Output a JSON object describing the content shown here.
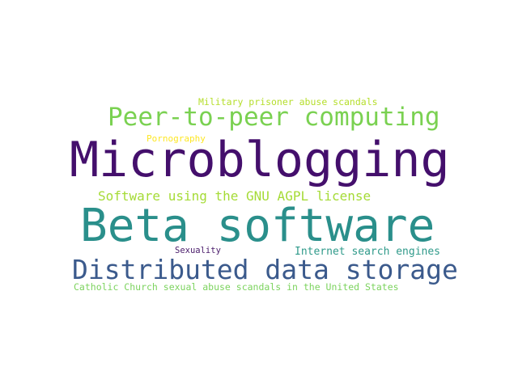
{
  "word_cloud": {
    "words": [
      {
        "id": "w-military",
        "text": "Military prisoner abuse scandals",
        "color": "#b5de2b"
      },
      {
        "id": "w-p2p",
        "text": "Peer-to-peer computing",
        "color": "#7ad151"
      },
      {
        "id": "w-porn",
        "text": "Pornography",
        "color": "#fde725"
      },
      {
        "id": "w-micro",
        "text": "Microblogging",
        "color": "#440f6c"
      },
      {
        "id": "w-agpl",
        "text": "Software using the GNU AGPL license",
        "color": "#a5db36"
      },
      {
        "id": "w-beta",
        "text": "Beta software",
        "color": "#2a8f8b"
      },
      {
        "id": "w-sex",
        "text": "Sexuality",
        "color": "#4a1c6b"
      },
      {
        "id": "w-isearch",
        "text": "Internet search engines",
        "color": "#2f9a8a"
      },
      {
        "id": "w-dds",
        "text": "Distributed data storage",
        "color": "#3b5a8c"
      },
      {
        "id": "w-catholic",
        "text": "Catholic Church sexual abuse scandals in the United States",
        "color": "#7cd35e"
      }
    ]
  }
}
